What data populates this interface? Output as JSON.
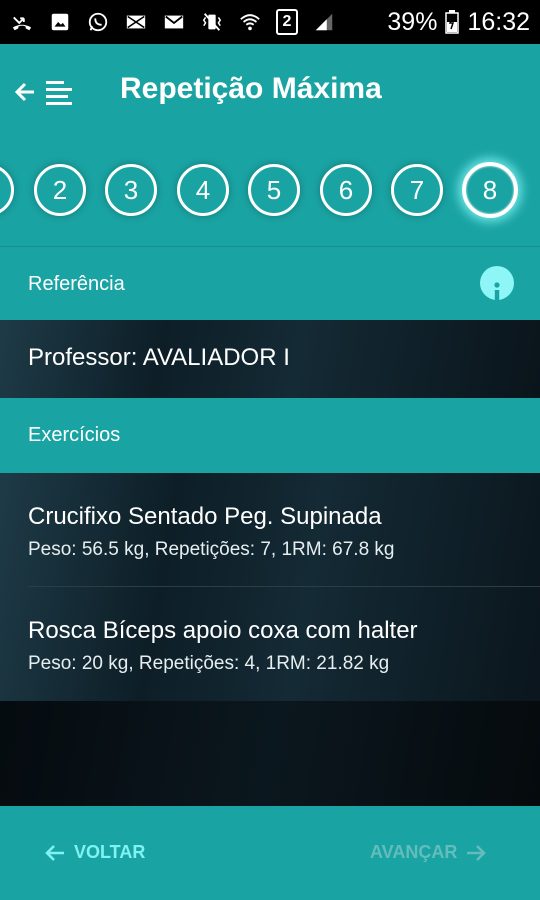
{
  "status_bar": {
    "icons": [
      "missed-call-icon",
      "image-icon",
      "whatsapp-icon",
      "mail-icon",
      "gmail-icon",
      "vibrate-icon",
      "wifi-icon",
      "sim-2-icon",
      "signal-icon"
    ],
    "sim_label": "2",
    "battery": "39%",
    "time": "16:32"
  },
  "header": {
    "title": "Repetição Máxima"
  },
  "steps": {
    "items": [
      "2",
      "3",
      "4",
      "5",
      "6",
      "7",
      "8"
    ],
    "active": "8"
  },
  "reference": {
    "label": "Referência",
    "professor": "Professor: AVALIADOR I"
  },
  "exercises": {
    "label": "Exercícios",
    "items": [
      {
        "name": "Crucifixo Sentado Peg. Supinada",
        "details": "Peso: 56.5 kg, Repetições: 7, 1RM: 67.8 kg"
      },
      {
        "name": "Rosca Bíceps apoio coxa com halter",
        "details": "Peso: 20 kg, Repetições: 4, 1RM: 21.82 kg"
      }
    ]
  },
  "footer": {
    "back_label": "VOLTAR",
    "next_label": "AVANÇAR"
  },
  "colors": {
    "teal": "#1aa3a3",
    "accent": "#7ff3f3",
    "dark": "#0c1a22"
  }
}
